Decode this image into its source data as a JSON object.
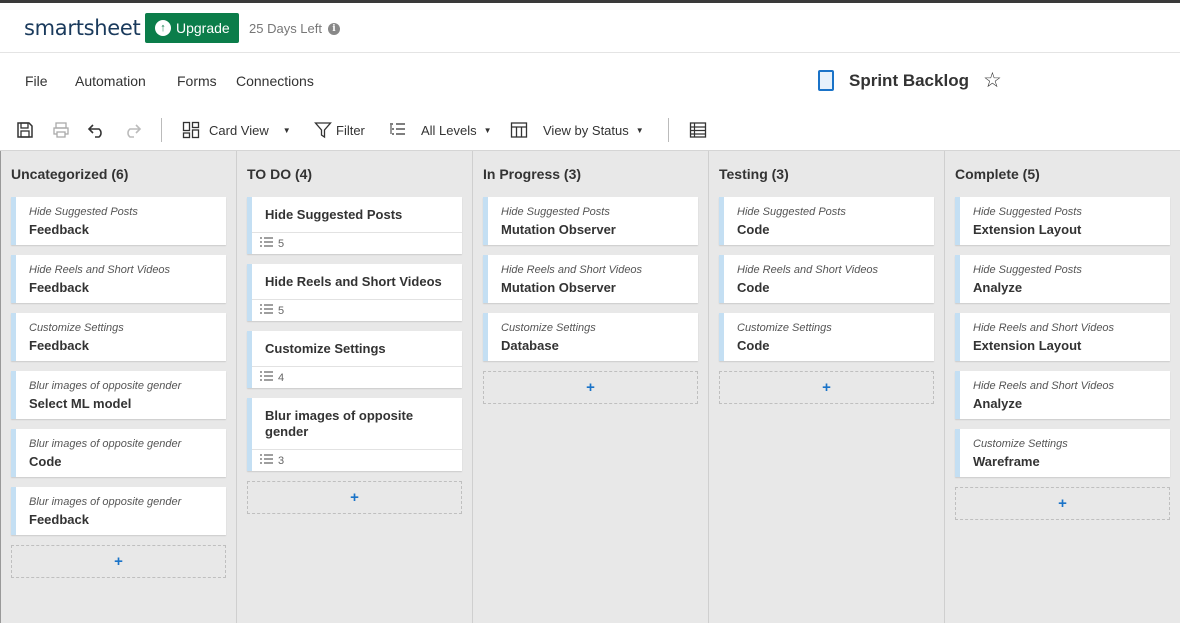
{
  "brand": {
    "logo": "smartsheet",
    "upgrade_label": "Upgrade",
    "days_left": "25 Days Left"
  },
  "menu": {
    "file": "File",
    "automation": "Automation",
    "forms": "Forms",
    "connections": "Connections"
  },
  "sheet": {
    "title": "Sprint Backlog"
  },
  "toolbar": {
    "card_view": "Card View",
    "filter": "Filter",
    "all_levels": "All Levels",
    "view_by": "View by Status"
  },
  "icons": {
    "save": "save-icon",
    "print": "print-icon",
    "undo": "undo-icon",
    "redo": "redo-icon",
    "card_view": "grid-icon",
    "filter": "filter-icon",
    "levels": "levels-icon",
    "view_by": "columns-icon",
    "grid": "grid-view-icon",
    "star": "star-icon",
    "info": "info-icon",
    "upgrade": "arrow-up-icon"
  },
  "colors": {
    "accent": "#1a73c8",
    "upgrade": "#0b7d4a",
    "card_stripe": "#c4dff3",
    "board_bg": "#e8e8e8"
  },
  "add_label": "+",
  "columns": [
    {
      "header": "Uncategorized (6)",
      "cards": [
        {
          "sub": "Hide Suggested Posts",
          "main": "Feedback"
        },
        {
          "sub": "Hide Reels and Short Videos",
          "main": "Feedback"
        },
        {
          "sub": "Customize Settings",
          "main": "Feedback"
        },
        {
          "sub": "Blur images of opposite gender",
          "main": "Select ML model"
        },
        {
          "sub": "Blur images of opposite gender",
          "main": "Code"
        },
        {
          "sub": "Blur images of opposite gender",
          "main": "Feedback"
        }
      ]
    },
    {
      "header": "TO DO (4)",
      "cards": [
        {
          "title": "Hide Suggested Posts",
          "count": "5"
        },
        {
          "title": "Hide Reels and Short Videos",
          "count": "5"
        },
        {
          "title": "Customize Settings",
          "count": "4"
        },
        {
          "title": "Blur images of opposite gender",
          "count": "3"
        }
      ]
    },
    {
      "header": "In Progress (3)",
      "cards": [
        {
          "sub": "Hide Suggested Posts",
          "main": "Mutation Observer"
        },
        {
          "sub": "Hide Reels and Short Videos",
          "main": "Mutation Observer"
        },
        {
          "sub": "Customize Settings",
          "main": "Database"
        }
      ]
    },
    {
      "header": "Testing (3)",
      "cards": [
        {
          "sub": "Hide Suggested Posts",
          "main": "Code"
        },
        {
          "sub": "Hide Reels and Short Videos",
          "main": "Code"
        },
        {
          "sub": "Customize Settings",
          "main": "Code"
        }
      ]
    },
    {
      "header": "Complete (5)",
      "cards": [
        {
          "sub": "Hide Suggested Posts",
          "main": "Extension Layout"
        },
        {
          "sub": "Hide Suggested Posts",
          "main": "Analyze"
        },
        {
          "sub": "Hide Reels and Short Videos",
          "main": "Extension Layout"
        },
        {
          "sub": "Hide Reels and Short Videos",
          "main": "Analyze"
        },
        {
          "sub": "Customize Settings",
          "main": "Wareframe"
        }
      ]
    }
  ]
}
